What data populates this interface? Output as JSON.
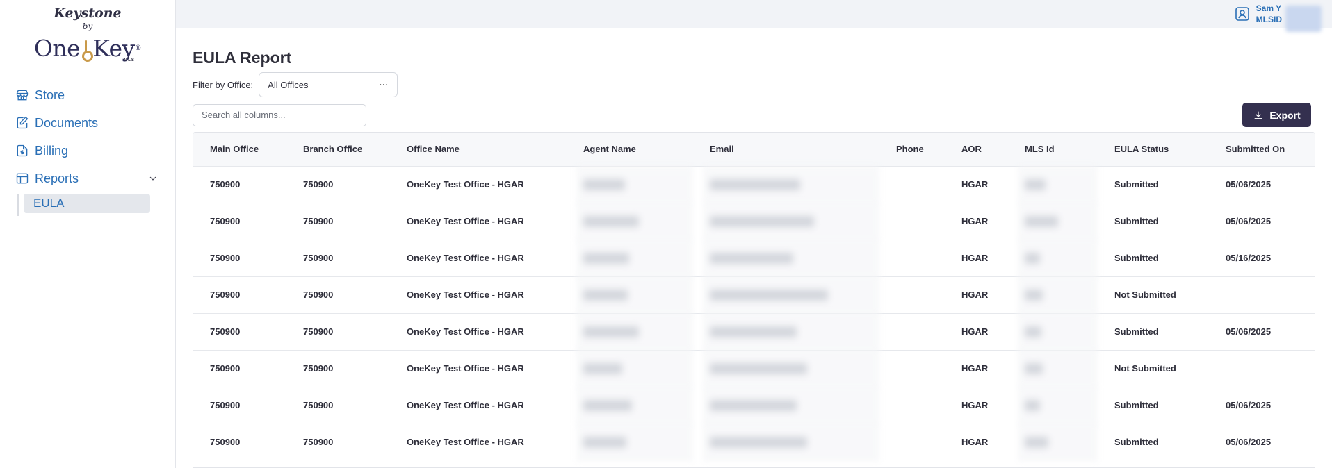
{
  "brand": {
    "line1": "Keystone",
    "line2": "by",
    "one": "One",
    "key": "Key",
    "reg": "®",
    "mls": "MLS"
  },
  "nav": {
    "store": "Store",
    "documents": "Documents",
    "billing": "Billing",
    "reports": "Reports",
    "eula": "EULA"
  },
  "user": {
    "name": "Sam Y",
    "mlsid": "MLSID"
  },
  "page": {
    "title": "EULA Report",
    "filter_label": "Filter by Office:",
    "filter_value": "All Offices",
    "search_placeholder": "Search all columns...",
    "export_label": "Export"
  },
  "table": {
    "headers": [
      "Main Office",
      "Branch Office",
      "Office Name",
      "Agent Name",
      "Email",
      "Phone",
      "AOR",
      "MLS Id",
      "EULA Status",
      "Submitted On"
    ],
    "rows": [
      {
        "main": "750900",
        "branch": "750900",
        "office": "OneKey Test Office - HGAR",
        "aor": "HGAR",
        "status": "Submitted",
        "date": "05/06/2025"
      },
      {
        "main": "750900",
        "branch": "750900",
        "office": "OneKey Test Office - HGAR",
        "aor": "HGAR",
        "status": "Submitted",
        "date": "05/06/2025"
      },
      {
        "main": "750900",
        "branch": "750900",
        "office": "OneKey Test Office - HGAR",
        "aor": "HGAR",
        "status": "Submitted",
        "date": "05/16/2025"
      },
      {
        "main": "750900",
        "branch": "750900",
        "office": "OneKey Test Office - HGAR",
        "aor": "HGAR",
        "status": "Not Submitted",
        "date": ""
      },
      {
        "main": "750900",
        "branch": "750900",
        "office": "OneKey Test Office - HGAR",
        "aor": "HGAR",
        "status": "Submitted",
        "date": "05/06/2025"
      },
      {
        "main": "750900",
        "branch": "750900",
        "office": "OneKey Test Office - HGAR",
        "aor": "HGAR",
        "status": "Not Submitted",
        "date": ""
      },
      {
        "main": "750900",
        "branch": "750900",
        "office": "OneKey Test Office - HGAR",
        "aor": "HGAR",
        "status": "Submitted",
        "date": "05/06/2025"
      },
      {
        "main": "750900",
        "branch": "750900",
        "office": "OneKey Test Office - HGAR",
        "aor": "HGAR",
        "status": "Submitted",
        "date": "05/06/2025"
      }
    ]
  },
  "colors": {
    "accent": "#2a6fb6",
    "button": "#34304f",
    "gold": "#c99a4a"
  }
}
